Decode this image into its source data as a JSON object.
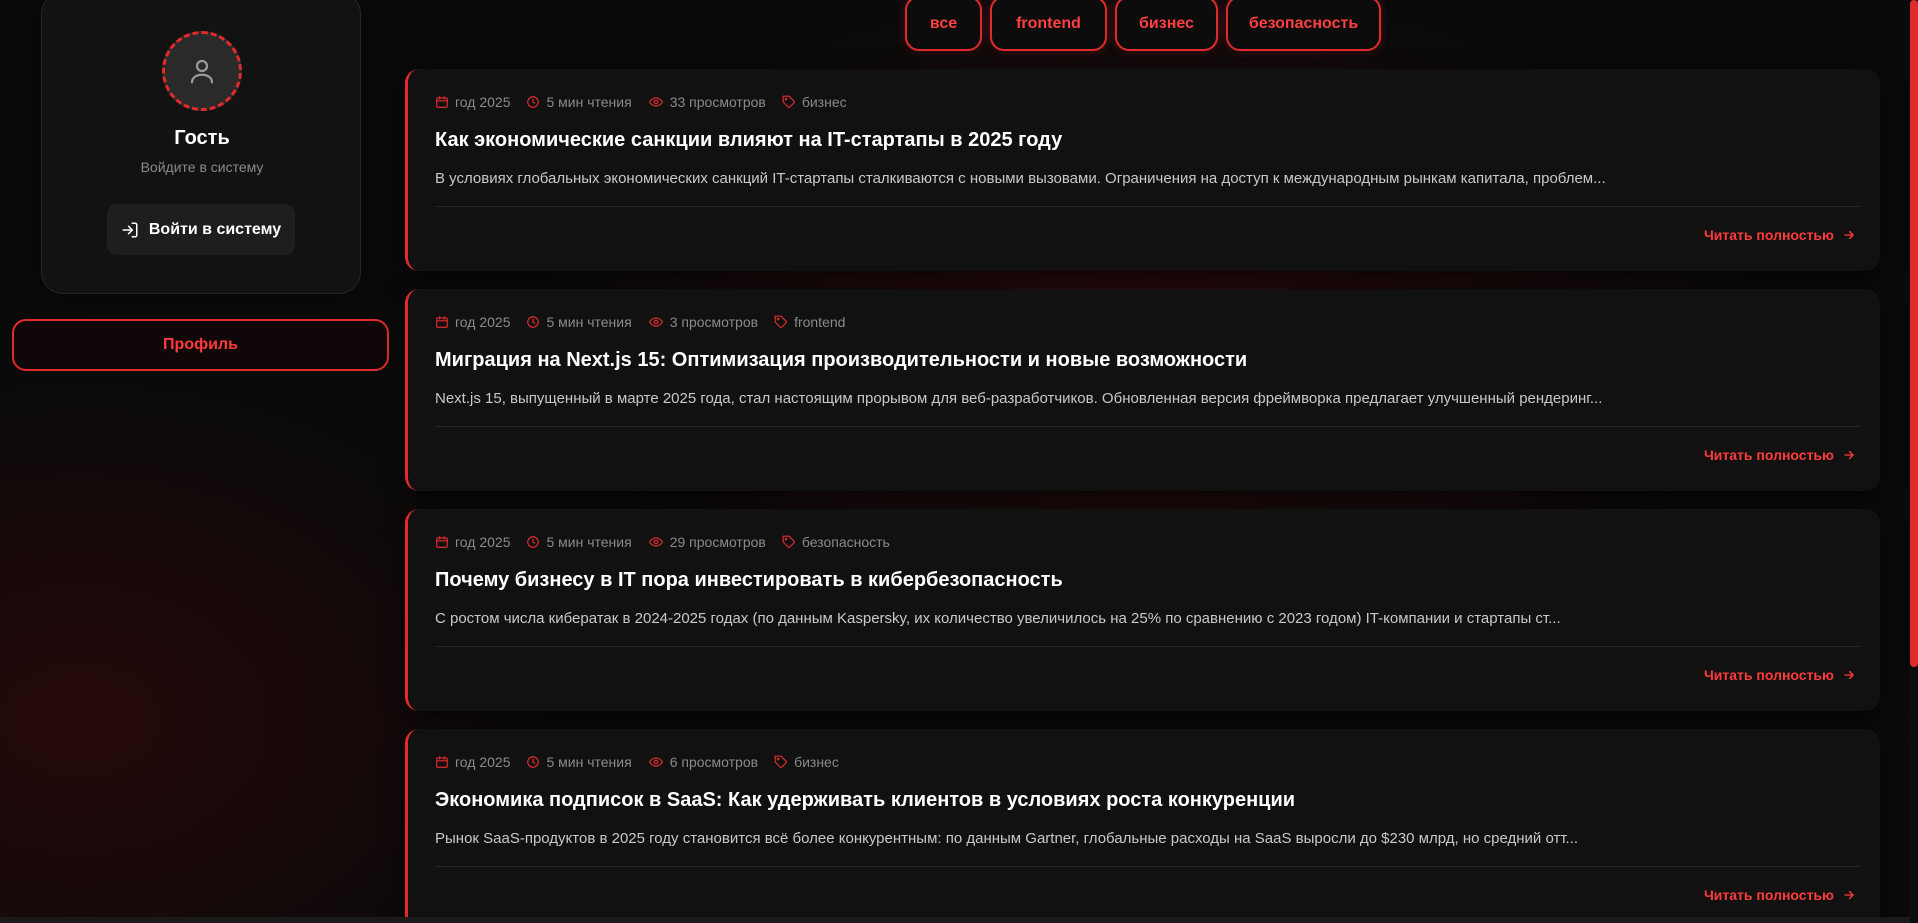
{
  "sidebar": {
    "user_name": "Гость",
    "user_hint": "Войдите в систему",
    "login_label": "Войти в систему",
    "profile_label": "Профиль"
  },
  "filters": [
    {
      "label": "все"
    },
    {
      "label": "frontend"
    },
    {
      "label": "бизнес"
    },
    {
      "label": "безопасность"
    }
  ],
  "posts": [
    {
      "date": "год 2025",
      "read_time": "5 мин чтения",
      "views": "33 просмотров",
      "tag": "бизнес",
      "title": "Как экономические санкции влияют на IT-стартапы в 2025 году",
      "excerpt": "В условиях глобальных экономических санкций IT-стартапы сталкиваются с новыми вызовами. Ограничения на доступ к международным рынкам капитала, проблем...",
      "read_more": "Читать полностью"
    },
    {
      "date": "год 2025",
      "read_time": "5 мин чтения",
      "views": "3 просмотров",
      "tag": "frontend",
      "title": "Миграция на Next.js 15: Оптимизация производительности и новые возможности",
      "excerpt": "Next.js 15, выпущенный в марте 2025 года, стал настоящим прорывом для веб-разработчиков. Обновленная версия фреймворка предлагает улучшенный рендеринг...",
      "read_more": "Читать полностью"
    },
    {
      "date": "год 2025",
      "read_time": "5 мин чтения",
      "views": "29 просмотров",
      "tag": "безопасность",
      "title": "Почему бизнесу в IT пора инвестировать в кибербезопасность",
      "excerpt": "С ростом числа кибератак в 2024-2025 годах (по данным Kaspersky, их количество увеличилось на 25% по сравнению с 2023 годом) IT-компании и стартапы ст...",
      "read_more": "Читать полностью"
    },
    {
      "date": "год 2025",
      "read_time": "5 мин чтения",
      "views": "6 просмотров",
      "tag": "бизнес",
      "title": "Экономика подписок в SaaS: Как удерживать клиентов в условиях роста конкуренции",
      "excerpt": "Рынок SaaS-продуктов в 2025 году становится всё более конкурентным: по данным Gartner, глобальные расходы на SaaS выросли до $230 млрд, но средний отт...",
      "read_more": "Читать полностью"
    }
  ],
  "icons": {
    "avatar": "user-icon",
    "login": "login-icon",
    "date": "calendar-icon",
    "read_time": "clock-icon",
    "views": "eye-icon",
    "tag": "tag-icon",
    "read_more": "arrow-right-icon"
  },
  "colors": {
    "accent": "#e12b2b",
    "accent_text": "#ff3b3b",
    "background": "#0a0a0a",
    "card": "#111111"
  }
}
